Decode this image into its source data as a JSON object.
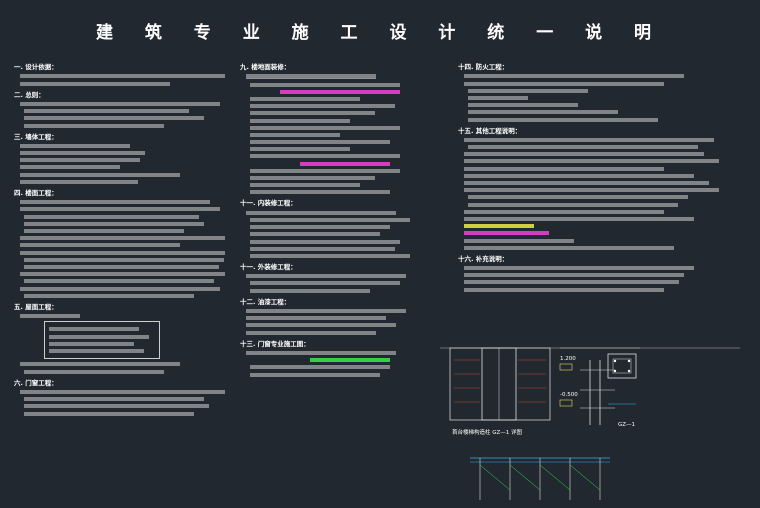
{
  "document": {
    "title": "建 筑 专 业 施 工 设 计 统 一 说 明"
  },
  "columns": {
    "left": {
      "sections": [
        "一. 设计依据：",
        "二. 总则：",
        "三. 墙体工程：",
        "四. 楼面工程：",
        "五. 屋面工程：",
        "六. 门窗工程："
      ]
    },
    "middle": {
      "sections": [
        "九. 楼地面装修：",
        "十一. 内装修工程：",
        "十一. 外装修工程：",
        "十二. 油漆工程：",
        "十三. 门窗专业施工图："
      ]
    },
    "right": {
      "sections": [
        "十四. 防火工程：",
        "十五. 其他工程说明：",
        "十六. 补充说明："
      ]
    }
  },
  "detail": {
    "caption": "首台楼梯构造柱 GZ—1 详图",
    "label_gz": "GZ—1",
    "dim_a": "1.200",
    "dim_b": "-0.500"
  }
}
